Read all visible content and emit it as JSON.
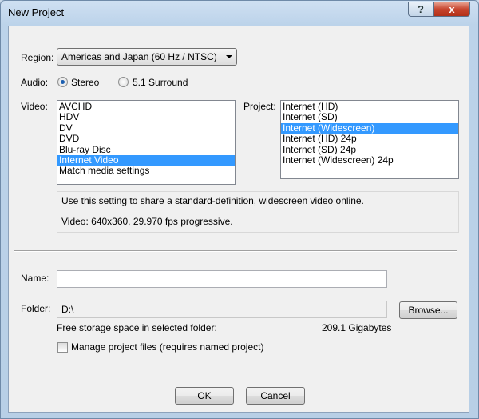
{
  "window": {
    "title": "New Project",
    "help_label": "?",
    "close_label": "x"
  },
  "region": {
    "label": "Region:",
    "selected": "Americas and Japan (60 Hz / NTSC)"
  },
  "audio": {
    "label": "Audio:",
    "options": [
      {
        "label": "Stereo",
        "checked": true
      },
      {
        "label": "5.1 Surround",
        "checked": false
      }
    ]
  },
  "video": {
    "label": "Video:",
    "items": [
      "AVCHD",
      "HDV",
      "DV",
      "DVD",
      "Blu-ray Disc",
      "Internet Video",
      "Match media settings"
    ],
    "selected": "Internet Video"
  },
  "project": {
    "label": "Project:",
    "items": [
      "Internet (HD)",
      "Internet (SD)",
      "Internet (Widescreen)",
      "Internet (HD) 24p",
      "Internet (SD) 24p",
      "Internet (Widescreen) 24p"
    ],
    "selected": "Internet (Widescreen)"
  },
  "info": {
    "line1": "Use this setting to share a standard-definition, widescreen video online.",
    "line2": "Video: 640x360, 29.970 fps progressive."
  },
  "name": {
    "label": "Name:",
    "value": ""
  },
  "folder": {
    "label": "Folder:",
    "value": "D:\\",
    "browse_label": "Browse...",
    "free_label": "Free storage space in selected folder:",
    "free_value": "209.1 Gigabytes"
  },
  "manage": {
    "label": "Manage project files (requires named project)",
    "checked": false
  },
  "buttons": {
    "ok": "OK",
    "cancel": "Cancel"
  }
}
